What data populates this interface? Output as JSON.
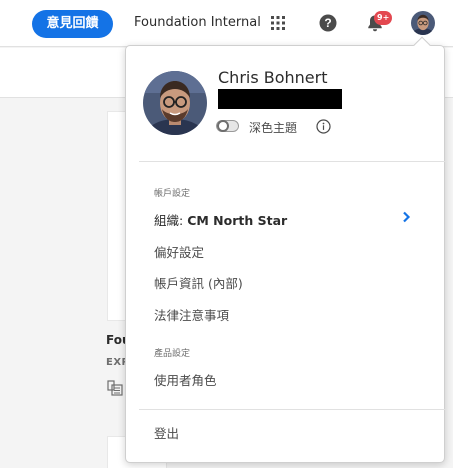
{
  "topbar": {
    "feedback_label": "意見回饋",
    "org_name": "Foundation Internal",
    "icons": [
      "apps-grid-icon",
      "help-icon",
      "bell-icon",
      "avatar"
    ],
    "notification_badge": "9+",
    "accent_color": "#1473e6",
    "badge_color": "#e34850"
  },
  "background": {
    "card_title": "Fou",
    "card_subtitle": "EXP"
  },
  "profile_menu": {
    "user_name": "Chris Bohnert",
    "dark_theme_label": "深色主題",
    "dark_theme_enabled": false,
    "account_section_label": "帳戶設定",
    "org_prefix": "組織: ",
    "org_value": "CM North Star",
    "preferences_label": "偏好設定",
    "account_info_label": "帳戶資訊 (內部)",
    "legal_label": "法律注意事項",
    "product_section_label": "產品設定",
    "user_roles_label": "使用者角色",
    "sign_out_label": "登出"
  }
}
